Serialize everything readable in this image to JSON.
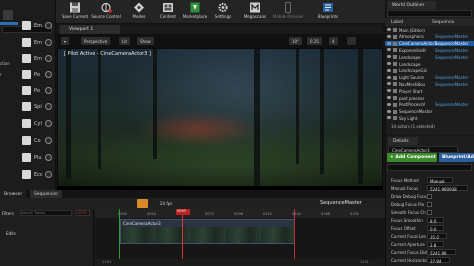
{
  "toolbar": {
    "save_current": "Save Current",
    "source_control": "Source Control",
    "modes": "Modes",
    "content": "Content",
    "marketplace": "Marketplace",
    "settings": "Settings",
    "megascans": "Megascans",
    "mobile_preview": "Mobile Preview",
    "blueprints": "Blueprints"
  },
  "modes_panel": {
    "items": [
      "Em",
      "Em",
      "Em",
      "Po",
      "Po",
      "Spi",
      "Cyl",
      "Co",
      "Plu",
      "Ecc"
    ],
    "side_labels": [
      "ction",
      "r"
    ]
  },
  "viewport": {
    "tab": "Viewport 1",
    "perspective": "Perspective",
    "lit": "Lit",
    "show": "Show",
    "fov": "10°",
    "snap": "0.25",
    "scale": "4",
    "pilot_label": "[ Pilot Active - CineCameraActor3 ]"
  },
  "world_outliner": {
    "tab": "World Outliner",
    "col_label": "Label",
    "col_type": "Sequence",
    "rows": [
      {
        "name": "Main (Editor)",
        "type": ""
      },
      {
        "name": "Atmospheric",
        "type": "SequenceMaster"
      },
      {
        "name": "CineCameraActor3",
        "type": "SequenceMaster"
      },
      {
        "name": "ExponentialH",
        "type": "SequenceMaster"
      },
      {
        "name": "Landscape",
        "type": "SequenceMaster"
      },
      {
        "name": "Landscape",
        "type": ""
      },
      {
        "name": "LandscapeGiz",
        "type": ""
      },
      {
        "name": "Light Source",
        "type": "SequenceMaster"
      },
      {
        "name": "NavMeshBou",
        "type": "SequenceMaster"
      },
      {
        "name": "Player Start",
        "type": ""
      },
      {
        "name": "post process",
        "type": ""
      },
      {
        "name": "PostProcessV",
        "type": "SequenceMaster"
      },
      {
        "name": "SequenceMaster",
        "type": ""
      },
      {
        "name": "Sky Light",
        "type": ""
      }
    ],
    "status": "14 actors (1 selected)"
  },
  "details": {
    "tab": "Details",
    "actor_name": "CineCameraActor3",
    "add_component": "+ Add Component",
    "blueprint": "Blueprint/Add",
    "properties": [
      {
        "label": "Focus Method",
        "value": "Manual"
      },
      {
        "label": "Manual Focus",
        "value": "5241.960938"
      },
      {
        "label": "Draw Debug Focu",
        "value": ""
      },
      {
        "label": "Debug Focus Pla",
        "value": ""
      },
      {
        "label": "Smooth Focus Ch",
        "value": ""
      },
      {
        "label": "Focus Smoothin",
        "value": "8.0"
      },
      {
        "label": "Focus Offset",
        "value": "0.0"
      },
      {
        "label": "Current Focal Len",
        "value": "35.0"
      },
      {
        "label": "Current Aperture",
        "value": "2.8"
      },
      {
        "label": "Current Focus Dist",
        "value": "5241.96"
      },
      {
        "label": "Current Horizontal F",
        "value": "37.84"
      }
    ]
  },
  "sequencer": {
    "tabs": [
      "Browser",
      "Sequencer"
    ],
    "title": "SequenceMaster",
    "filters": "Filters",
    "search_placeholder": "Search Tracks",
    "fps": "24 fps",
    "current_frame": "0093",
    "start_frame": "0000",
    "track_label": "Edits",
    "shot_label": "CineCameraActor3",
    "tick_labels": [
      "0000",
      "0024",
      "0048",
      "0072",
      "0096",
      "0120",
      "0144",
      "0168",
      "0192"
    ],
    "footer_left": "-1101",
    "footer_right": "1101"
  },
  "colors": {
    "selection": "#1c5ea8",
    "add_component": "#3a8a2c",
    "playhead": "#dd3333"
  }
}
